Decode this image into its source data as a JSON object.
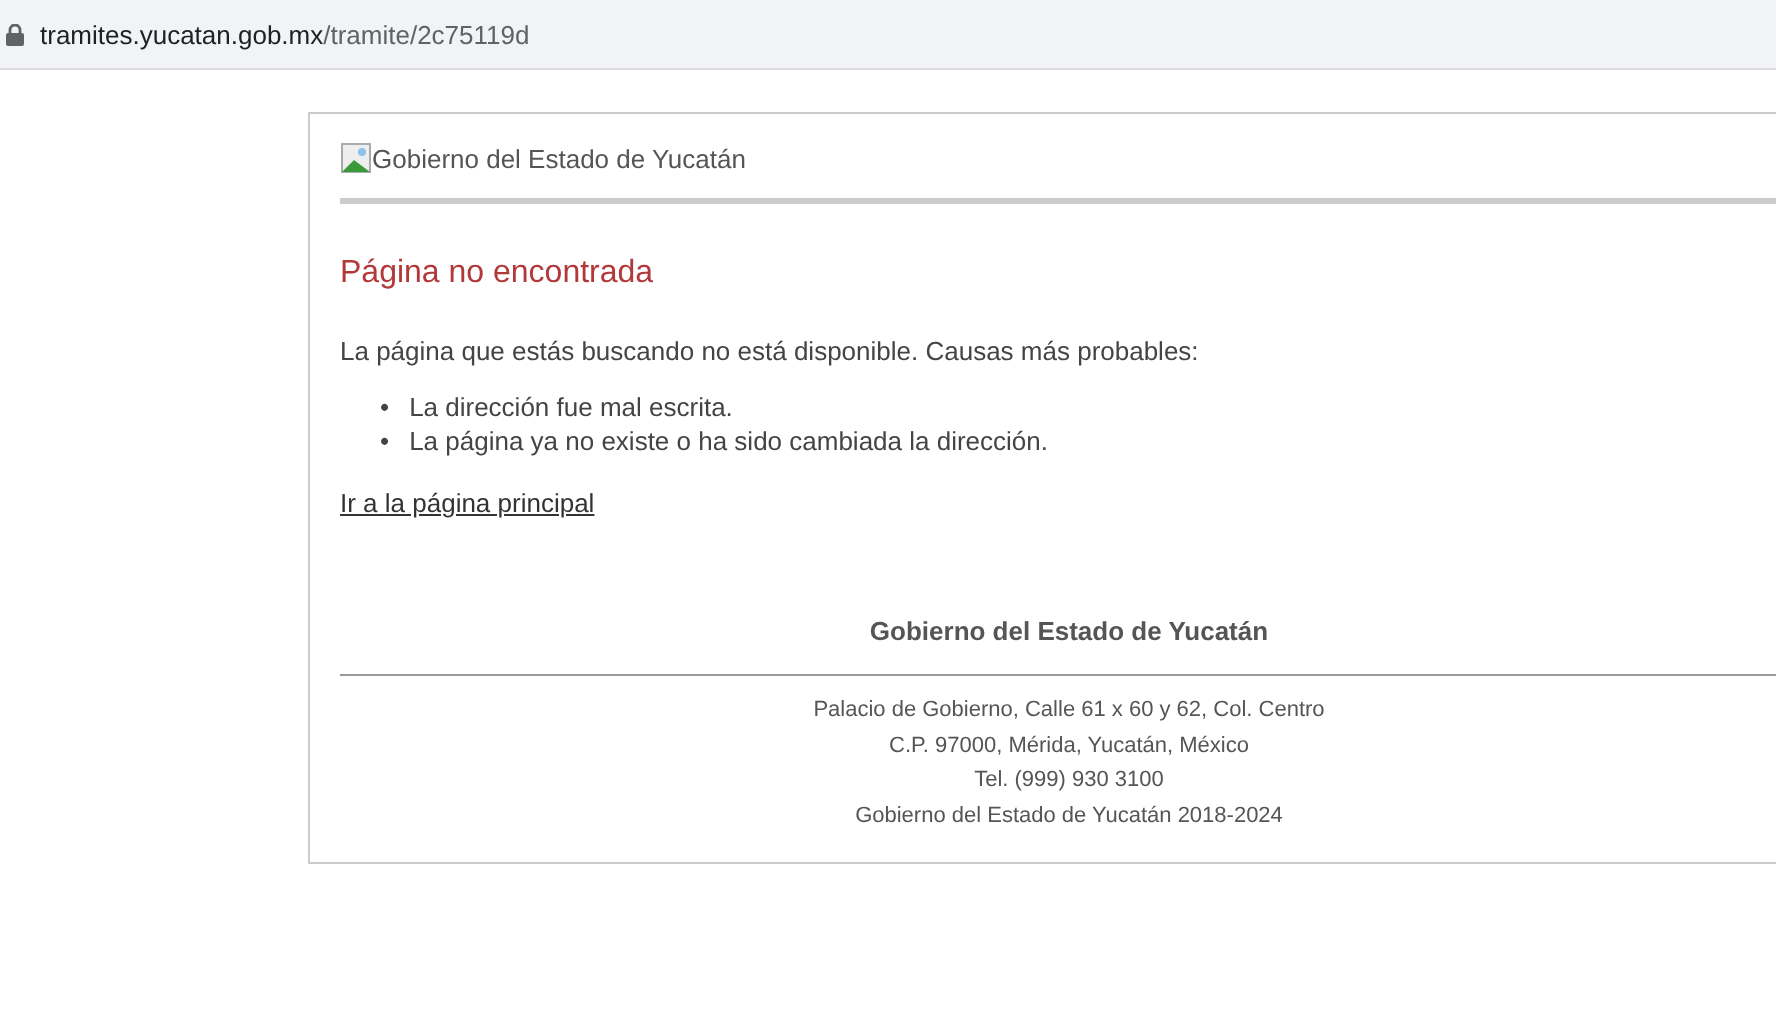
{
  "address_bar": {
    "host": "tramites.yucatan.gob.mx",
    "path": "/tramite/2c75119d"
  },
  "header": {
    "logo_alt": "Gobierno del Estado de Yucatán"
  },
  "title": "Página no encontrada",
  "message": "La página que estás buscando no está disponible. Causas más probables:",
  "causes": [
    {
      "marker": "•",
      "text": "La dirección fue mal escrita."
    },
    {
      "marker": "•",
      "text": "La página ya no existe o ha sido cambiada la dirección."
    }
  ],
  "home_link": "Ir a la página principal",
  "footer": {
    "title": "Gobierno del Estado de Yucatán",
    "lines": [
      "Palacio de Gobierno, Calle 61 x 60 y 62, Col. Centro",
      "C.P. 97000, Mérida, Yucatán, México",
      "Tel. (999) 930 3100",
      "Gobierno del Estado de Yucatán 2018-2024"
    ]
  }
}
